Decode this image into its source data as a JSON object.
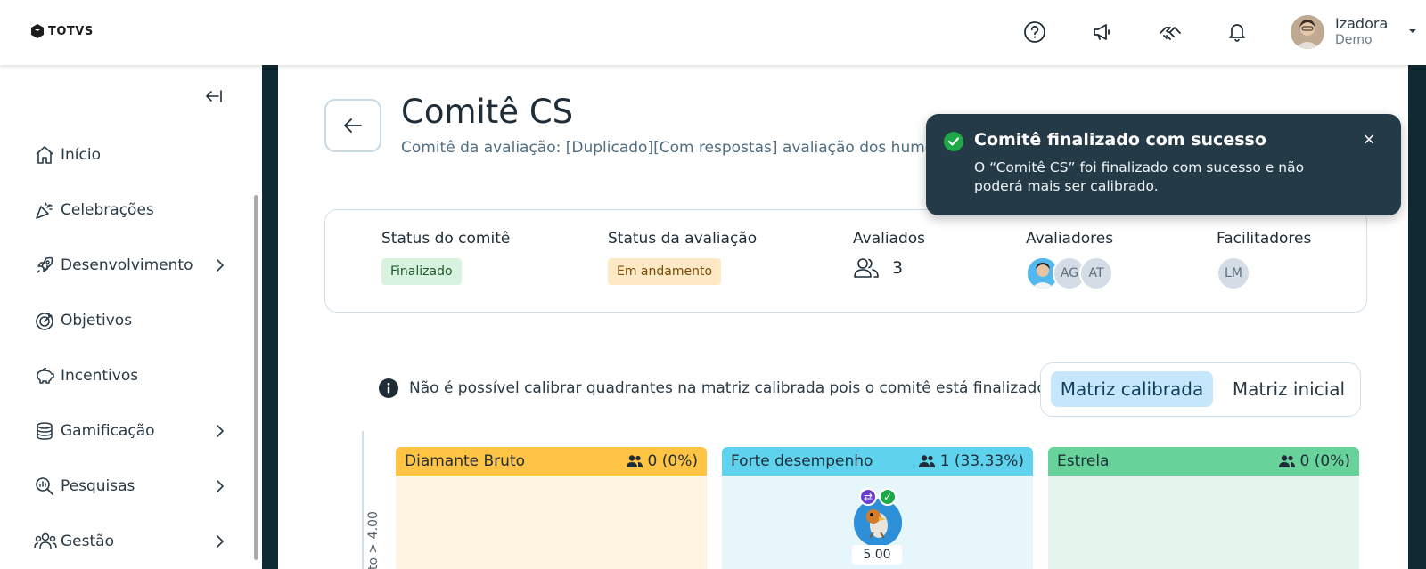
{
  "header": {
    "logo_text": "TOTVS",
    "icons": [
      "help-icon",
      "megaphone-icon",
      "handshake-icon",
      "bell-icon"
    ],
    "user": {
      "name": "Izadora",
      "role": "Demo"
    }
  },
  "sidebar": {
    "items": [
      {
        "label": "Início",
        "icon": "home-icon",
        "has_submenu": false
      },
      {
        "label": "Celebrações",
        "icon": "party-icon",
        "has_submenu": false
      },
      {
        "label": "Desenvolvimento",
        "icon": "rocket-icon",
        "has_submenu": true
      },
      {
        "label": "Objetivos",
        "icon": "target-icon",
        "has_submenu": false
      },
      {
        "label": "Incentivos",
        "icon": "piggy-bank-icon",
        "has_submenu": false
      },
      {
        "label": "Gamificação",
        "icon": "coins-icon",
        "has_submenu": true
      },
      {
        "label": "Pesquisas",
        "icon": "search-chart-icon",
        "has_submenu": true
      },
      {
        "label": "Gestão",
        "icon": "people-icon",
        "has_submenu": true
      }
    ]
  },
  "page": {
    "title": "Comitê CS",
    "subtitle": "Comitê da avaliação: [Duplicado][Com respostas] avaliação dos humoris"
  },
  "status": {
    "committee_label": "Status do comitê",
    "committee_value": "Finalizado",
    "evaluation_label": "Status da avaliação",
    "evaluation_value": "Em andamento",
    "evaluated_label": "Avaliados",
    "evaluated_count": "3",
    "evaluators_label": "Avaliadores",
    "evaluators": [
      "AG",
      "AT"
    ],
    "facilitators_label": "Facilitadores",
    "facilitators": [
      "LM"
    ]
  },
  "notice": "Não é possível calibrar quadrantes na matriz calibrada pois o comitê está finalizado.",
  "matrix_toggle": {
    "active": "Matriz calibrada",
    "inactive": "Matriz inicial"
  },
  "axis_label": "to > 4.00",
  "quadrants": [
    {
      "name": "Diamante Bruto",
      "count": "0 (0%)",
      "head_color": "#ffc444",
      "body_color": "#fff5e0"
    },
    {
      "name": "Forte desempenho",
      "count": "1 (33.33%)",
      "head_color": "#5fd3ee",
      "body_color": "#e6f6fb",
      "person_score": "5.00"
    },
    {
      "name": "Estrela",
      "count": "0 (0%)",
      "head_color": "#68d29b",
      "body_color": "#e6f6ee"
    }
  ],
  "toast": {
    "title": "Comitê finalizado com sucesso",
    "message": "O “Comitê CS” foi finalizado com sucesso e não poderá mais ser calibrado.",
    "close": "×"
  }
}
